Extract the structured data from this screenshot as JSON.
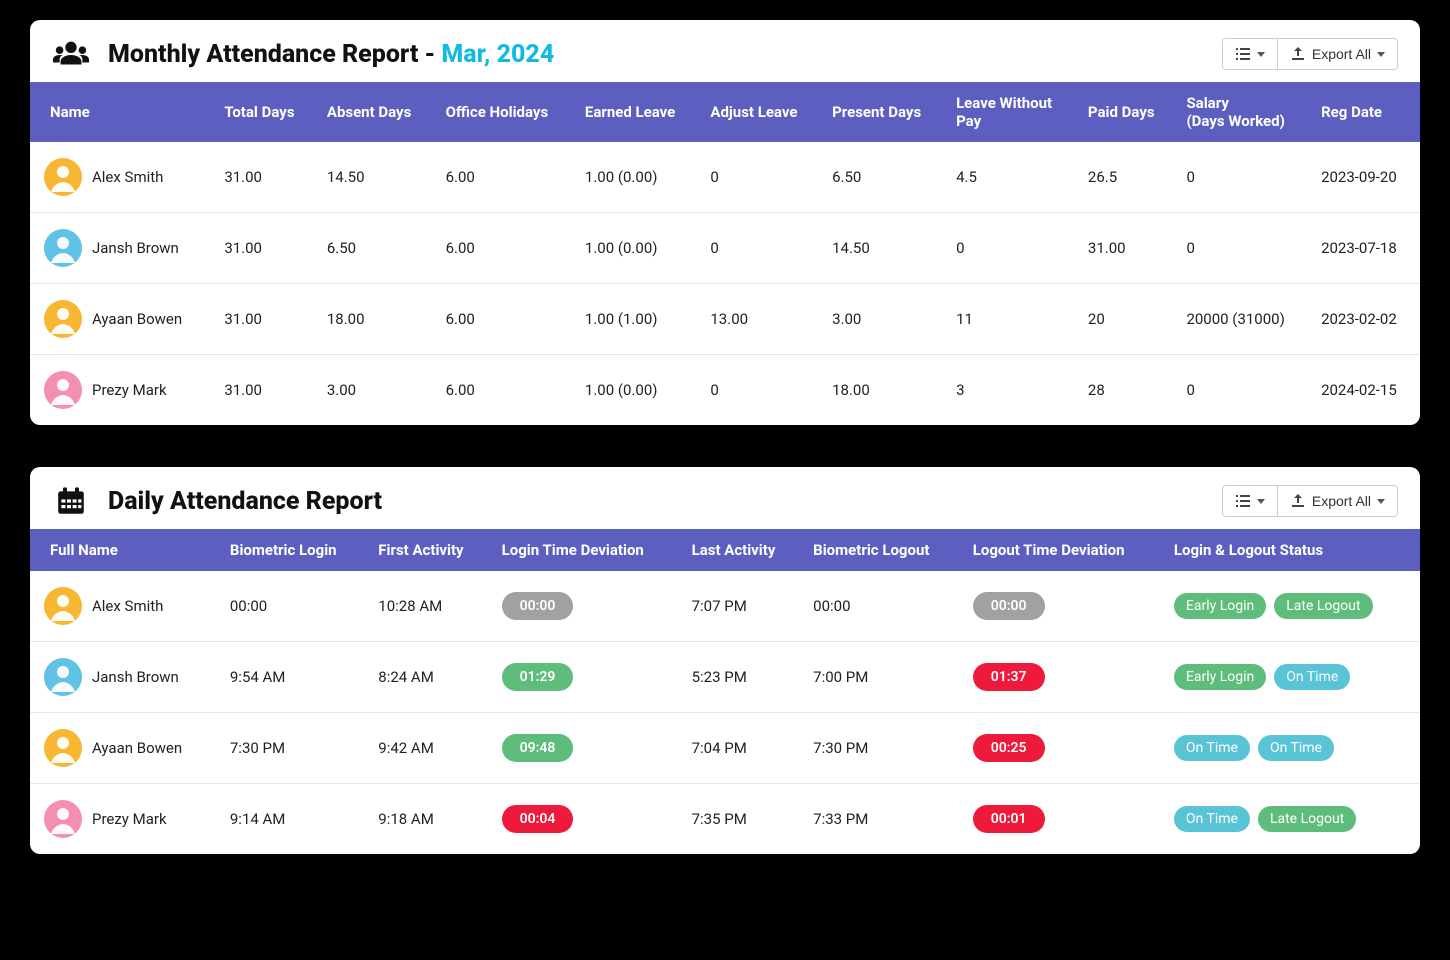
{
  "monthly": {
    "title_prefix": "Monthly Attendance Report - ",
    "title_period": "Mar, 2024",
    "export_label": "Export All",
    "columns": [
      "Name",
      "Total Days",
      "Absent Days",
      "Office Holidays",
      "Earned Leave",
      "Adjust Leave",
      "Present Days",
      "Leave Without Pay",
      "Paid Days",
      "Salary (Days Worked)",
      "Reg Date"
    ],
    "rows": [
      {
        "name": "Alex Smith",
        "avatar_bg": "#f7b733",
        "total": "31.00",
        "absent": "14.50",
        "holidays": "6.00",
        "earned": "1.00 (0.00)",
        "adjust": "0",
        "present": "6.50",
        "lwp": "4.5",
        "paid": "26.5",
        "salary": "0",
        "reg": "2023-09-20"
      },
      {
        "name": "Jansh Brown",
        "avatar_bg": "#60c3e6",
        "total": "31.00",
        "absent": "6.50",
        "holidays": "6.00",
        "earned": "1.00 (0.00)",
        "adjust": "0",
        "present": "14.50",
        "lwp": "0",
        "paid": "31.00",
        "salary": "0",
        "reg": "2023-07-18"
      },
      {
        "name": "Ayaan Bowen",
        "avatar_bg": "#f7b733",
        "total": "31.00",
        "absent": "18.00",
        "holidays": "6.00",
        "earned": "1.00 (1.00)",
        "adjust": "13.00",
        "present": "3.00",
        "lwp": "11",
        "paid": "20",
        "salary": "20000 (31000)",
        "reg": "2023-02-02"
      },
      {
        "name": "Prezy Mark",
        "avatar_bg": "#f48fb1",
        "total": "31.00",
        "absent": "3.00",
        "holidays": "6.00",
        "earned": "1.00 (0.00)",
        "adjust": "0",
        "present": "18.00",
        "lwp": "3",
        "paid": "28",
        "salary": "0",
        "reg": "2024-02-15"
      }
    ]
  },
  "daily": {
    "title": "Daily Attendance Report",
    "export_label": "Export All",
    "columns": [
      "Full Name",
      "Biometric Login",
      "First Activity",
      "Login Time Deviation",
      "Last Activity",
      "Biometric Logout",
      "Logout Time Deviation",
      "Login & Logout Status"
    ],
    "rows": [
      {
        "name": "Alex Smith",
        "avatar_bg": "#f7b733",
        "bio_login": "00:00",
        "first": "10:28 AM",
        "login_dev": "00:00",
        "login_dev_color": "gray",
        "last": "7:07 PM",
        "bio_logout": "00:00",
        "logout_dev": "00:00",
        "logout_dev_color": "gray",
        "status": [
          {
            "text": "Early Login",
            "color": "green"
          },
          {
            "text": "Late Logout",
            "color": "green"
          }
        ]
      },
      {
        "name": "Jansh Brown",
        "avatar_bg": "#60c3e6",
        "bio_login": "9:54 AM",
        "first": "8:24 AM",
        "login_dev": "01:29",
        "login_dev_color": "green",
        "last": "5:23 PM",
        "bio_logout": "7:00 PM",
        "logout_dev": "01:37",
        "logout_dev_color": "red",
        "status": [
          {
            "text": "Early Login",
            "color": "green"
          },
          {
            "text": "On Time",
            "color": "teal"
          }
        ]
      },
      {
        "name": "Ayaan Bowen",
        "avatar_bg": "#f7b733",
        "bio_login": "7:30 PM",
        "first": "9:42 AM",
        "login_dev": "09:48",
        "login_dev_color": "green",
        "last": "7:04 PM",
        "bio_logout": "7:30 PM",
        "logout_dev": "00:25",
        "logout_dev_color": "red",
        "status": [
          {
            "text": "On Time",
            "color": "teal"
          },
          {
            "text": "On Time",
            "color": "teal"
          }
        ]
      },
      {
        "name": "Prezy Mark",
        "avatar_bg": "#f48fb1",
        "bio_login": "9:14 AM",
        "first": "9:18 AM",
        "login_dev": "00:04",
        "login_dev_color": "red",
        "last": "7:35 PM",
        "bio_logout": "7:33 PM",
        "logout_dev": "00:01",
        "logout_dev_color": "red",
        "status": [
          {
            "text": "On Time",
            "color": "teal"
          },
          {
            "text": "Late Logout",
            "color": "green"
          }
        ]
      }
    ]
  }
}
